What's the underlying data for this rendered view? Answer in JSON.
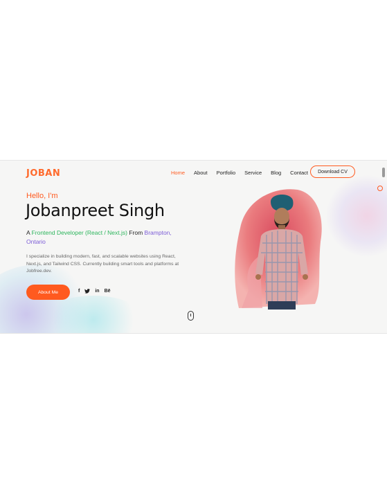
{
  "header": {
    "logo": "JOBAN",
    "nav": [
      "Home",
      "About",
      "Portfolio",
      "Service",
      "Blog",
      "Contact"
    ],
    "active_nav": "Home",
    "cta": "Download CV"
  },
  "hero": {
    "greeting": "Hello, I'm",
    "name": "Jobanpreet Singh",
    "tagline": {
      "prefix": "A ",
      "role": "Frontend Developer (React / Next.js)",
      "middle": " From ",
      "location": "Brampton, Ontario"
    },
    "description": "I specialize in building modern, fast, and scalable websites using React, Next.js, and Tailwind CSS. Currently building smart tools and platforms at Jobfree.dev.",
    "primary_button": "About Me",
    "socials": [
      "f",
      "🐦",
      "in",
      "Bē"
    ]
  },
  "colors": {
    "accent": "#ff5a1f",
    "green": "#2cb55c",
    "purple": "#7b5bd6"
  },
  "icons": {
    "scroll_indicator": "mouse-scroll-icon"
  }
}
